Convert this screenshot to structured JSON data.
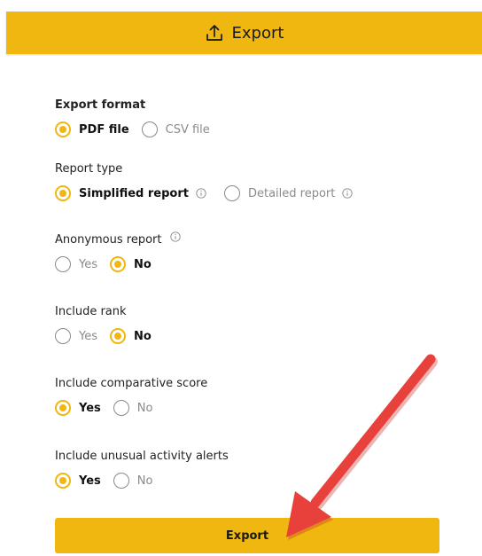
{
  "header": {
    "title": "Export",
    "icon": "upload-icon",
    "background": "#efb70f"
  },
  "form": {
    "export_format": {
      "label": "Export format",
      "options": [
        {
          "label": "PDF file",
          "checked": true
        },
        {
          "label": "CSV file",
          "checked": false
        }
      ]
    },
    "report_type": {
      "label": "Report type",
      "options": [
        {
          "label": "Simplified report",
          "checked": true,
          "info": true
        },
        {
          "label": "Detailed report",
          "checked": false,
          "info": true
        }
      ]
    },
    "anonymous_report": {
      "label": "Anonymous report",
      "info": true,
      "options": [
        {
          "label": "Yes",
          "checked": false
        },
        {
          "label": "No",
          "checked": true
        }
      ]
    },
    "include_rank": {
      "label": "Include rank",
      "options": [
        {
          "label": "Yes",
          "checked": false
        },
        {
          "label": "No",
          "checked": true
        }
      ]
    },
    "include_comparative_score": {
      "label": "Include comparative score",
      "options": [
        {
          "label": "Yes",
          "checked": true
        },
        {
          "label": "No",
          "checked": false
        }
      ]
    },
    "include_unusual_activity_alerts": {
      "label": "Include unusual activity alerts",
      "options": [
        {
          "label": "Yes",
          "checked": true
        },
        {
          "label": "No",
          "checked": false
        }
      ]
    }
  },
  "export_button": {
    "label": "Export"
  },
  "colors": {
    "accent": "#efb70f",
    "annotation_arrow": "#e8413c"
  }
}
